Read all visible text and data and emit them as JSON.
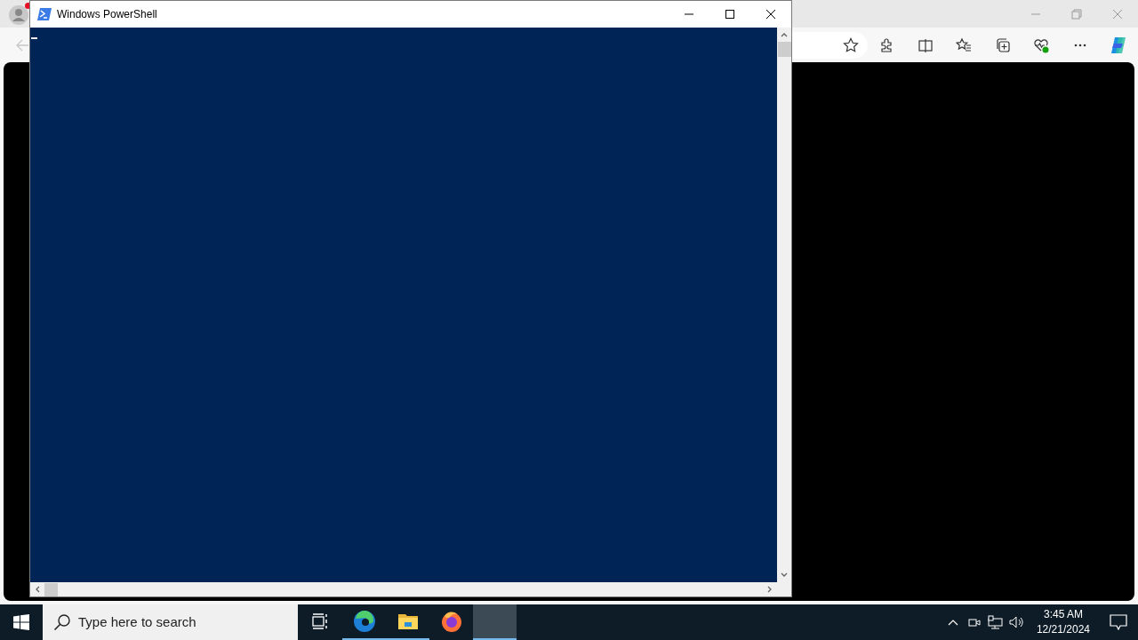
{
  "browser": {
    "profile": {
      "notification": true
    },
    "back_button": {
      "disabled": true
    }
  },
  "powershell": {
    "title": "Windows PowerShell",
    "cursor_visible": true
  },
  "taskbar": {
    "search": {
      "placeholder": "Type here to search"
    },
    "apps": [
      {
        "kind": "task-view",
        "running": false,
        "selected": false
      },
      {
        "kind": "edge",
        "running": true,
        "selected": false
      },
      {
        "kind": "explorer",
        "running": true,
        "selected": false
      },
      {
        "kind": "firefox",
        "running": false,
        "selected": false
      },
      {
        "kind": "blank",
        "running": true,
        "selected": true
      }
    ],
    "clock": {
      "time": "3:45 AM",
      "date": "12/21/2024"
    }
  }
}
